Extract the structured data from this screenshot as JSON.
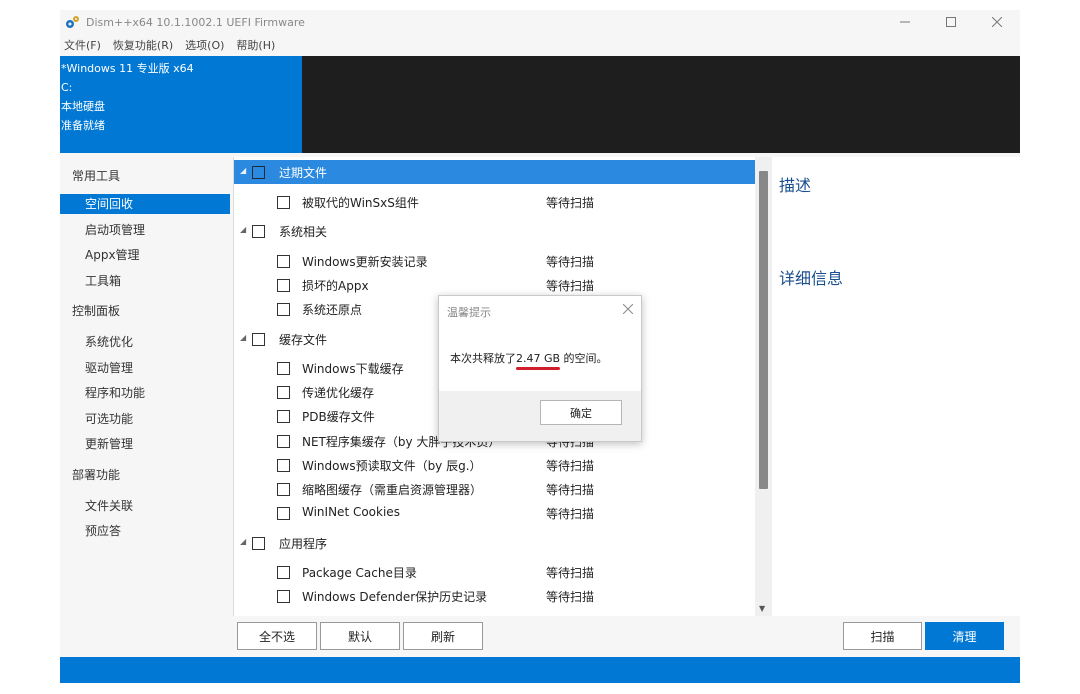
{
  "window": {
    "title": "Dism++x64 10.1.1002.1 UEFI Firmware"
  },
  "menu": {
    "items": [
      "文件(F)",
      "恢复功能(R)",
      "选项(O)",
      "帮助(H)"
    ]
  },
  "header": {
    "lines": [
      "*Windows 11 专业版 x64",
      "C:",
      "本地硬盘",
      "准备就绪"
    ]
  },
  "sidebar": {
    "sections": [
      {
        "title": "常用工具",
        "items": [
          "空间回收",
          "启动项管理",
          "Appx管理",
          "工具箱"
        ]
      },
      {
        "title": "控制面板",
        "items": [
          "系统优化",
          "驱动管理",
          "程序和功能",
          "可选功能",
          "更新管理"
        ]
      },
      {
        "title": "部署功能",
        "items": [
          "文件关联",
          "预应答"
        ]
      }
    ],
    "active_item": "空间回收"
  },
  "tree": {
    "rows": [
      {
        "label": "过期文件",
        "status": "",
        "group": true
      },
      {
        "label": "被取代的WinSxS组件",
        "status": "等待扫描",
        "group": false
      },
      {
        "label": "系统相关",
        "status": "",
        "group": true
      },
      {
        "label": "Windows更新安装记录",
        "status": "等待扫描",
        "group": false
      },
      {
        "label": "损坏的Appx",
        "status": "等待扫描",
        "group": false
      },
      {
        "label": "系统还原点",
        "status": "",
        "group": false
      },
      {
        "label": "缓存文件",
        "status": "",
        "group": true
      },
      {
        "label": "Windows下载缓存",
        "status": "",
        "group": false
      },
      {
        "label": "传递优化缓存",
        "status": "",
        "group": false
      },
      {
        "label": "PDB缓存文件",
        "status": "",
        "group": false
      },
      {
        "label": "NET程序集缓存（by 大胖子技术员）",
        "status": "等待扫描",
        "group": false
      },
      {
        "label": "Windows预读取文件（by 辰g.）",
        "status": "等待扫描",
        "group": false
      },
      {
        "label": "缩略图缓存（需重启资源管理器）",
        "status": "等待扫描",
        "group": false
      },
      {
        "label": "WinINet Cookies",
        "status": "等待扫描",
        "group": false
      },
      {
        "label": "应用程序",
        "status": "",
        "group": true
      },
      {
        "label": "Package Cache目录",
        "status": "等待扫描",
        "group": false
      },
      {
        "label": "Windows Defender保护历史记录",
        "status": "等待扫描",
        "group": false
      }
    ]
  },
  "buttons": {
    "deselect_all": "全不选",
    "default": "默认",
    "refresh": "刷新",
    "scan": "扫描",
    "clean": "清理"
  },
  "description": {
    "title": "描述",
    "details": "详细信息"
  },
  "dialog": {
    "title": "温馨提示",
    "message_prefix": "本次共释放了",
    "message_value": "2.47 GB",
    "message_suffix": " 的空间。",
    "ok": "确定"
  },
  "colors": {
    "accent": "#0078d4",
    "header_dark": "#1e1e1e",
    "selected_row": "#2b8ae0",
    "underline": "#d01e2a"
  }
}
